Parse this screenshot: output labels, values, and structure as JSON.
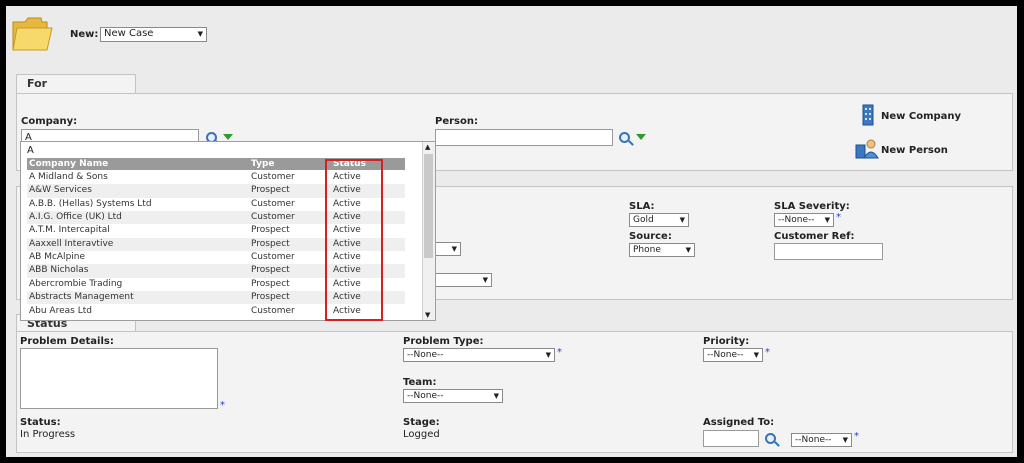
{
  "header": {
    "new_label": "New:",
    "new_select": "New Case"
  },
  "for_tab": {
    "title": "For"
  },
  "company": {
    "label": "Company:",
    "value": "A"
  },
  "person": {
    "label": "Person:",
    "value": ""
  },
  "actions": {
    "new_company": "New Company",
    "new_person": "New Person"
  },
  "dropdown": {
    "search_text": "A",
    "columns": [
      "Company Name",
      "Type",
      "Status"
    ],
    "rows": [
      {
        "name": "A Midland & Sons",
        "type": "Customer",
        "status": "Active"
      },
      {
        "name": "A&W Services",
        "type": "Prospect",
        "status": "Active"
      },
      {
        "name": "A.B.B. (Hellas) Systems Ltd",
        "type": "Customer",
        "status": "Active"
      },
      {
        "name": "A.I.G. Office (UK) Ltd",
        "type": "Customer",
        "status": "Active"
      },
      {
        "name": "A.T.M. Intercapital",
        "type": "Prospect",
        "status": "Active"
      },
      {
        "name": "Aaxxell Interavtive",
        "type": "Prospect",
        "status": "Active"
      },
      {
        "name": "AB McAlpine",
        "type": "Customer",
        "status": "Active"
      },
      {
        "name": "ABB Nicholas",
        "type": "Prospect",
        "status": "Active"
      },
      {
        "name": "Abercrombie Trading",
        "type": "Prospect",
        "status": "Active"
      },
      {
        "name": "Abstracts Management",
        "type": "Prospect",
        "status": "Active"
      },
      {
        "name": "Abu Areas Ltd",
        "type": "Customer",
        "status": "Active"
      }
    ]
  },
  "details": {
    "sla_label": "SLA:",
    "sla_value": "Gold",
    "sla_severity_label": "SLA Severity:",
    "sla_severity_value": "--None--",
    "source_label": "Source:",
    "source_value": "Phone",
    "customer_ref_label": "Customer Ref:",
    "customer_ref_value": ""
  },
  "status_section": {
    "tab_title": "Status",
    "problem_details_label": "Problem Details:",
    "problem_type_label": "Problem Type:",
    "problem_type_value": "--None--",
    "priority_label": "Priority:",
    "priority_value": "--None--",
    "team_label": "Team:",
    "team_value": "--None--",
    "status_label": "Status:",
    "status_value": "In Progress",
    "stage_label": "Stage:",
    "stage_value": "Logged",
    "assigned_label": "Assigned To:",
    "assigned_value": "--None--"
  },
  "colors": {
    "accent_required": "#2a3cc8",
    "highlight_box": "#d42020",
    "grid_header": "#9a9a9a"
  }
}
